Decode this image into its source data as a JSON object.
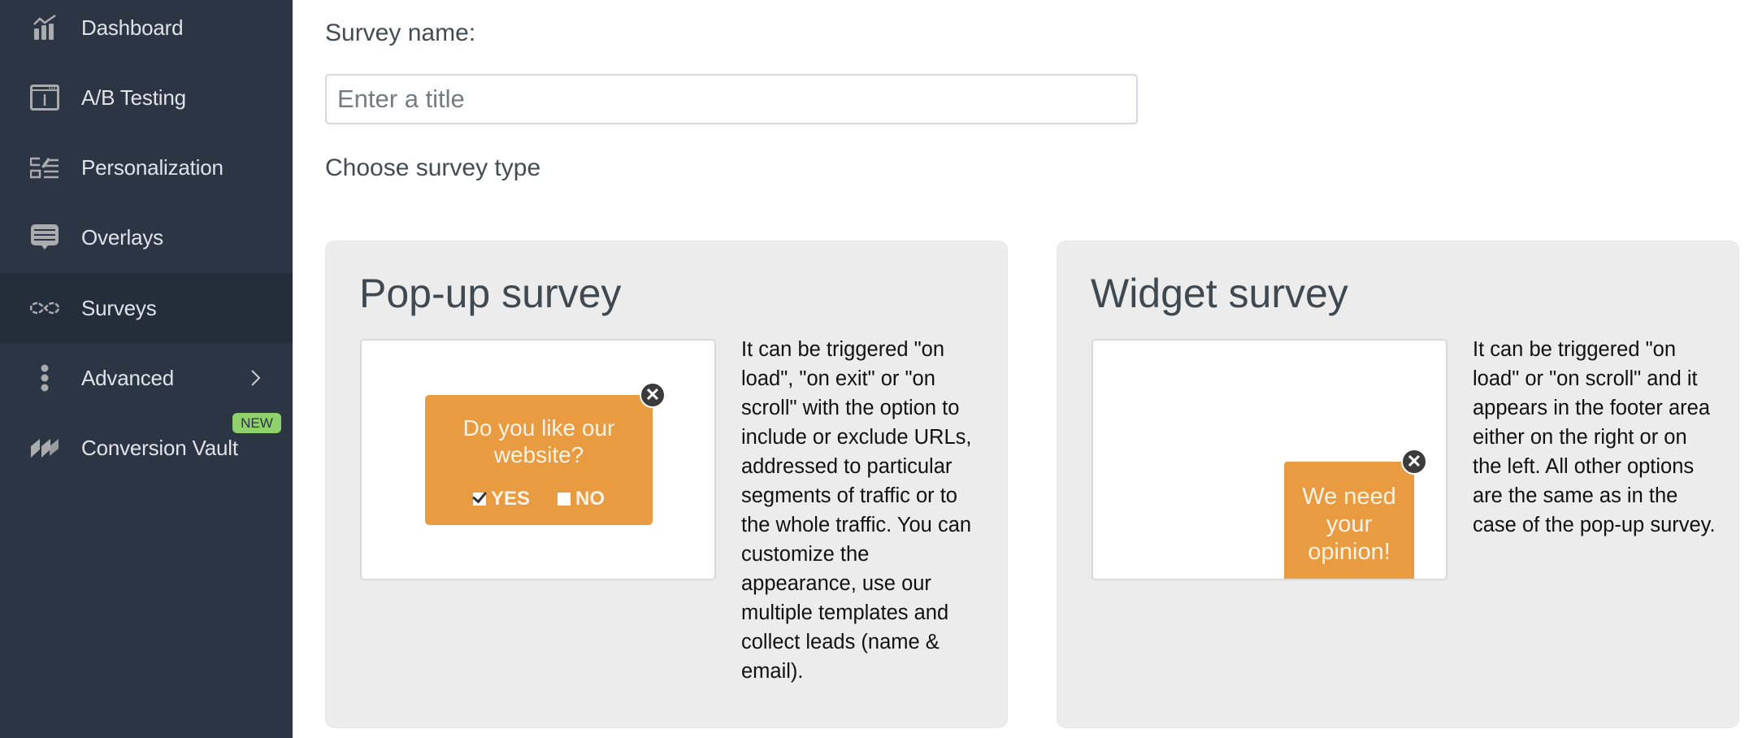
{
  "sidebar": {
    "items": [
      {
        "label": "Dashboard",
        "icon": "chart-icon"
      },
      {
        "label": "A/B Testing",
        "icon": "browser-window-icon"
      },
      {
        "label": "Personalization",
        "icon": "edit-list-icon"
      },
      {
        "label": "Overlays",
        "icon": "message-icon"
      },
      {
        "label": "Surveys",
        "icon": "infinity-icon",
        "active": true
      },
      {
        "label": "Advanced",
        "icon": "vertical-dots-icon",
        "has_submenu": true
      },
      {
        "label": "Conversion Vault",
        "icon": "stripes-icon",
        "badge": "NEW"
      }
    ],
    "colors": {
      "background": "#2b3544",
      "active": "#242d3a",
      "badge": "#8fd16a"
    }
  },
  "form": {
    "survey_name_label": "Survey name:",
    "title_input": {
      "value": "",
      "placeholder": "Enter a title"
    },
    "choose_type_label": "Choose survey type"
  },
  "survey_types": [
    {
      "title": "Pop-up survey",
      "preview": {
        "question": "Do you like our website?",
        "options": [
          {
            "label": "YES",
            "checked": true
          },
          {
            "label": "NO",
            "checked": false
          }
        ],
        "close_symbol": "✕"
      },
      "description": "It can be triggered \"on load\", \"on exit\" or \"on scroll\" with the option to include or exclude URLs, addressed to particular segments of traffic or to the whole traffic. You can customize the appearance, use our multiple templates and collect leads (name & email)."
    },
    {
      "title": "Widget survey",
      "preview": {
        "text": "We need your opinion!",
        "close_symbol": "✕"
      },
      "description": "It can be triggered \"on load\" or \"on scroll\" and it appears in the footer area either on the right or on the left. All other options are the same as in the case of the pop-up survey."
    }
  ],
  "colors": {
    "accent_orange": "#e89b41",
    "card_bg": "#ececec"
  }
}
